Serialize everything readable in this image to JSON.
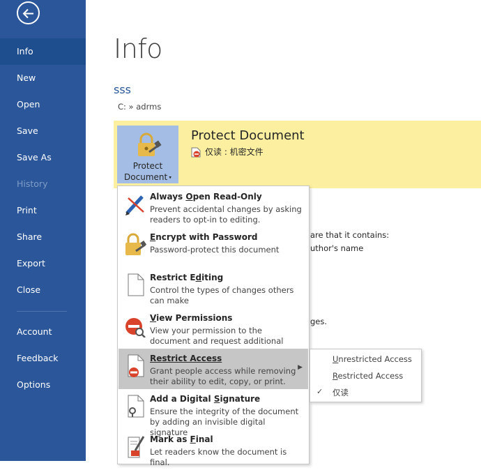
{
  "sidebar": {
    "items": [
      {
        "label": "Info",
        "active": true
      },
      {
        "label": "New"
      },
      {
        "label": "Open"
      },
      {
        "label": "Save"
      },
      {
        "label": "Save As"
      },
      {
        "label": "History",
        "disabled": true
      },
      {
        "label": "Print"
      },
      {
        "label": "Share"
      },
      {
        "label": "Export"
      },
      {
        "label": "Close"
      },
      {
        "label": "Account"
      },
      {
        "label": "Feedback"
      },
      {
        "label": "Options"
      }
    ]
  },
  "main": {
    "title": "Info",
    "doc_name": "sss",
    "doc_path": "C: » adrms",
    "protect": {
      "button_line1": "Protect",
      "button_line2": "Document",
      "title": "Protect Document",
      "status": "仅读 : 机密文件"
    },
    "background_text": {
      "line1": "are that it contains:",
      "line2": "uthor's name",
      "line3": "ges."
    }
  },
  "menu": {
    "items": [
      {
        "title_pre": "Always ",
        "title_u": "O",
        "title_post": "pen Read-Only",
        "desc": "Prevent accidental changes by asking readers to opt-in to editing."
      },
      {
        "title_pre": "",
        "title_u": "E",
        "title_post": "ncrypt with Password",
        "desc": "Password-protect this document"
      },
      {
        "title_pre": "Restrict E",
        "title_u": "d",
        "title_post": "iting",
        "desc": "Control the types of changes others can make"
      },
      {
        "title_pre": "",
        "title_u": "V",
        "title_post": "iew Permissions",
        "desc": "View your permission to the document and request additional access."
      },
      {
        "title_pre": "",
        "title_u": "Restrict Access",
        "title_post": "",
        "desc": "Grant people access while removing their ability to edit, copy, or print."
      },
      {
        "title_pre": "Add a Digital ",
        "title_u": "S",
        "title_post": "ignature",
        "desc": "Ensure the integrity of the document by adding an invisible digital signature"
      },
      {
        "title_pre": "Mark as ",
        "title_u": "F",
        "title_post": "inal",
        "desc": "Let readers know the document is final."
      }
    ]
  },
  "submenu": {
    "items": [
      {
        "label_u": "U",
        "label_post": "nrestricted Access"
      },
      {
        "label_u": "R",
        "label_post": "estricted Access"
      },
      {
        "label_u": "",
        "label_post": "仅读",
        "checked": true
      }
    ]
  },
  "colors": {
    "sidebar": "#2b579a",
    "active": "#1f4e8f",
    "band": "#fcf0a0",
    "protect_button": "#a4bde4",
    "highlight": "#c6c6c6"
  }
}
